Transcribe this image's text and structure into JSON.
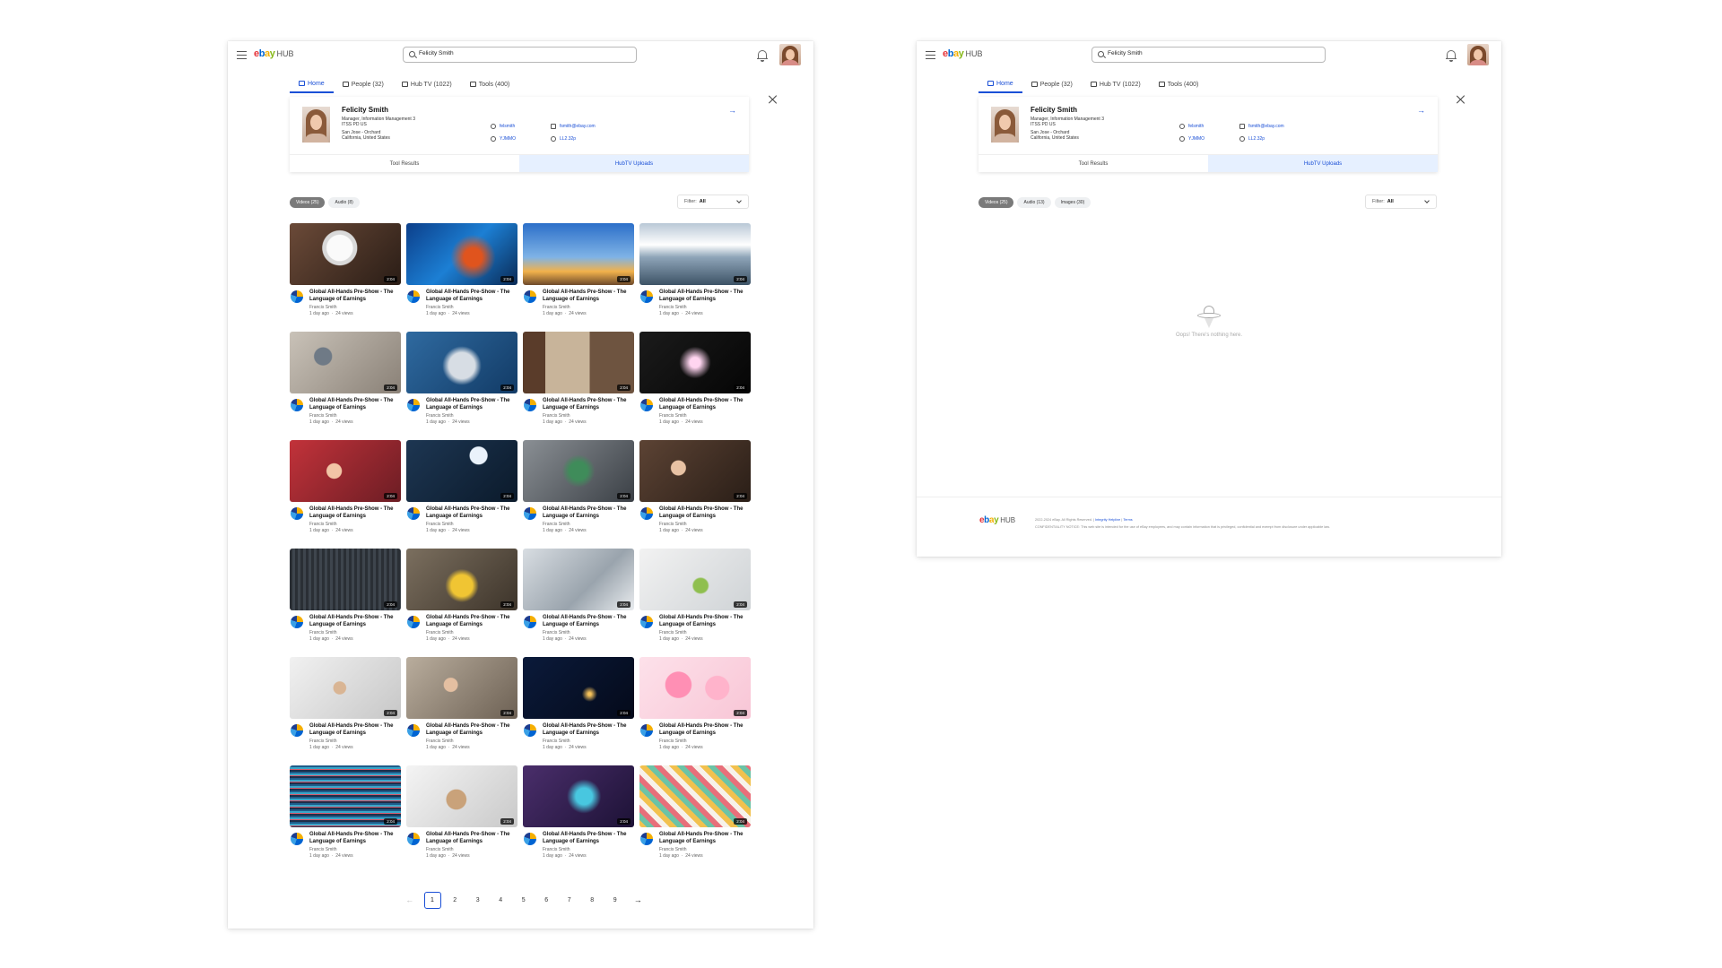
{
  "app": {
    "logo_letters": [
      "e",
      "b",
      "a",
      "y"
    ],
    "logo_suffix": "HUB"
  },
  "search": {
    "value": "Felicity Smith"
  },
  "tabs": [
    {
      "label": "Home",
      "icon": "home-icon"
    },
    {
      "label": "People (32)",
      "icon": "people-icon"
    },
    {
      "label": "Hub TV (1022)",
      "icon": "tv-icon"
    },
    {
      "label": "Tools (400)",
      "icon": "tools-icon"
    }
  ],
  "profile": {
    "name": "Felicity Smith",
    "title": "Manager, Information Management 3",
    "org": "ITSS PD US",
    "location_line1": "San Jose - Orchard",
    "location_line2": "California, United States",
    "username": "felsmith",
    "email": "fsmith@ebay.com",
    "code": "YJMMO",
    "desk": "LL2.32p",
    "subtabs": [
      "Tool Results",
      "HubTV Uploads"
    ]
  },
  "screenA": {
    "chips": [
      "Videos (25)",
      "Audio (8)"
    ],
    "filter_label": "Filter:",
    "filter_value": "All"
  },
  "screenB": {
    "chips": [
      "Videos (25)",
      "Audio (13)",
      "Images (30)"
    ],
    "filter_label": "Filter:",
    "filter_value": "All",
    "empty_text": "Oops! There's nothing here.",
    "footer_copyright": "2022-2024 eBay. All Rights Reserved.",
    "footer_links": [
      "Integrity Helpline",
      "Terms"
    ],
    "footer_notice": "CONFIDENTIALITY NOTICE: This web site is intended for the use of eBay employees, and may contain information that is privileged, confidential and exempt from disclosure under applicable law."
  },
  "video_card": {
    "title": "Global All-Hands Pre-Show - The Language of Earnings",
    "author": "Francis Smith",
    "age": "1 day ago",
    "views": "24 views",
    "duration": "2:04"
  },
  "thumbnails": [
    "robot",
    "blue-abstract",
    "sunset-dish",
    "clouds-lake",
    "desk-top",
    "laptop-blue",
    "office-shelves",
    "neon-sign",
    "team-red",
    "team-presentation",
    "laptop-landscape",
    "team-meeting",
    "circuit-board",
    "team-yellow",
    "glass-wall",
    "office-chairs",
    "meeting-room",
    "team-workshop",
    "night-earth",
    "pink-balloons",
    "glitch-data",
    "dog-laptop",
    "hand-device",
    "stationery"
  ],
  "pagination": {
    "pages": [
      "1",
      "2",
      "3",
      "4",
      "5",
      "6",
      "7",
      "8",
      "9"
    ],
    "current": "1",
    "prev": "←",
    "next": "→"
  }
}
